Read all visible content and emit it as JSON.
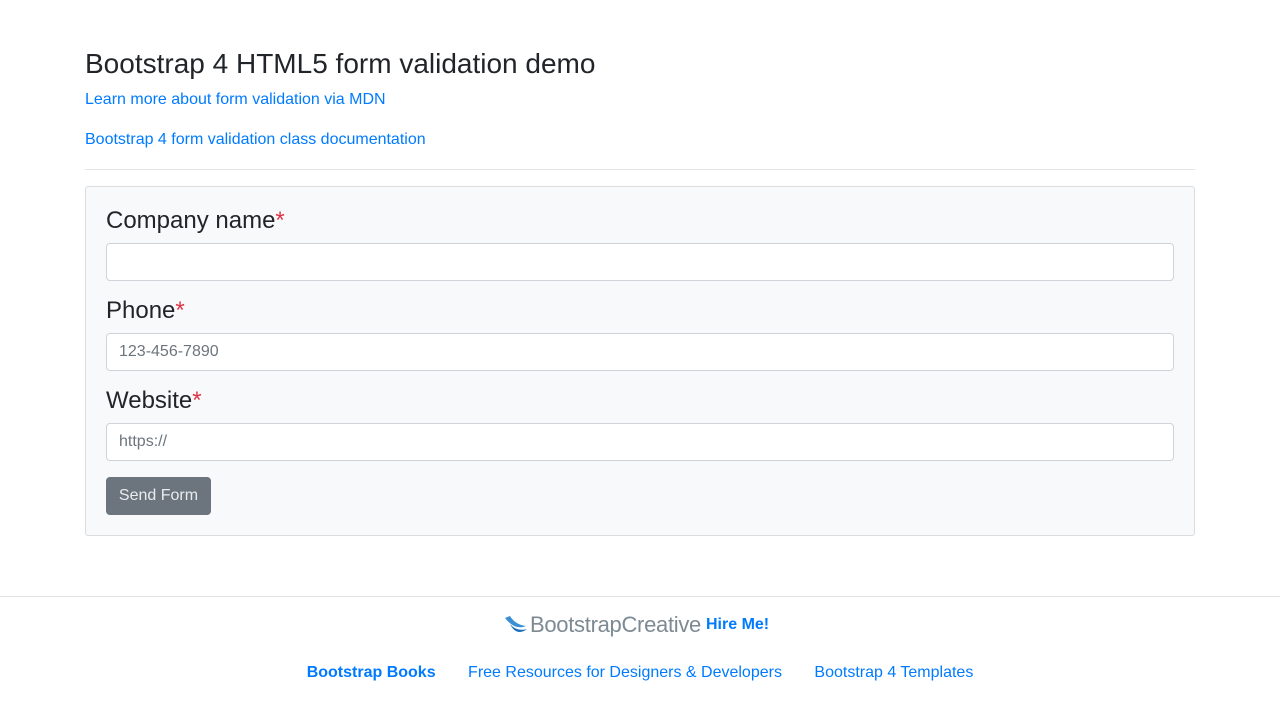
{
  "header": {
    "title": "Bootstrap 4 HTML5 form validation demo",
    "links": [
      "Learn more about form validation via MDN",
      "Bootstrap 4 form validation class documentation"
    ]
  },
  "form": {
    "required_marker": "*",
    "fields": [
      {
        "label": "Company name",
        "value": "",
        "placeholder": ""
      },
      {
        "label": "Phone",
        "value": "",
        "placeholder": "123-456-7890"
      },
      {
        "label": "Website",
        "value": "",
        "placeholder": "https://"
      }
    ],
    "submit_label": "Send Form"
  },
  "footer": {
    "brand_name": "BootstrapCreative",
    "brand_logo_icon": "bird-wing-icon",
    "hire_label": "Hire Me!",
    "links": [
      "Bootstrap Books",
      "Free Resources for Designers & Developers",
      "Bootstrap 4 Templates"
    ]
  },
  "colors": {
    "link": "#007bff",
    "required": "#dc3545",
    "button": "#6c757d",
    "card_bg": "#f8f9fa",
    "brand_gray": "#7d8a93"
  }
}
